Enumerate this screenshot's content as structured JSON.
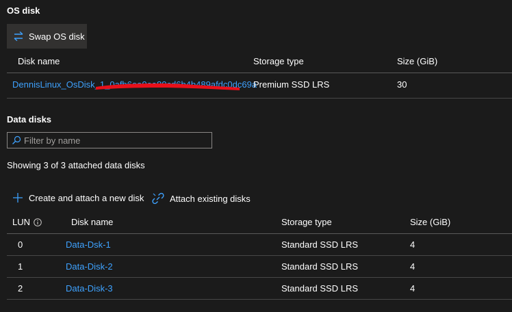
{
  "os_disk": {
    "title": "OS disk",
    "swap_button": "Swap OS disk",
    "columns": {
      "name": "Disk name",
      "storage": "Storage type",
      "size": "Size (GiB)"
    },
    "row": {
      "name": "DennisLinux_OsDisk_1_0afb6ea0ea80cd6b4b489afdc0dc69a",
      "storage": "Premium SSD LRS",
      "size": "30"
    }
  },
  "data_disks": {
    "title": "Data disks",
    "filter_placeholder": "Filter by name",
    "showing": "Showing 3 of 3 attached data disks",
    "create_button": "Create and attach a new disk",
    "attach_button": "Attach existing disks",
    "columns": {
      "lun": "LUN",
      "name": "Disk name",
      "storage": "Storage type",
      "size": "Size (GiB)"
    },
    "rows": [
      {
        "lun": "0",
        "name": "Data-Dsk-1",
        "storage": "Standard SSD LRS",
        "size": "4"
      },
      {
        "lun": "1",
        "name": "Data-Disk-2",
        "storage": "Standard SSD LRS",
        "size": "4"
      },
      {
        "lun": "2",
        "name": "Data-Disk-3",
        "storage": "Standard SSD LRS",
        "size": "4"
      }
    ]
  },
  "colors": {
    "background": "#1b1b1b",
    "link": "#3ea2ff",
    "accent": "#0078d4",
    "redaction": "#e8101a"
  },
  "icons": {
    "swap": "swap-arrows-icon",
    "search": "search-icon",
    "add": "plus-icon",
    "attach": "link-icon",
    "info": "info-icon"
  }
}
